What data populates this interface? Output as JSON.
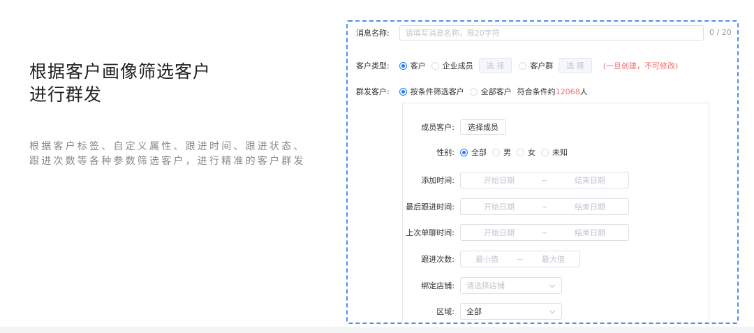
{
  "hero": {
    "title_line1": "根据客户画像筛选客户",
    "title_line2": "进行群发",
    "description": "根据客户标签、自定义属性、跟进时间、跟进状态、跟进次数等各种参数筛选客户，进行精准的客户群发"
  },
  "form": {
    "message_name": {
      "label": "消息名称:",
      "placeholder": "请填写消息名称，限20字符",
      "counter": "0 / 20"
    },
    "customer_type": {
      "label": "客户类型:",
      "options": [
        "客户",
        "企业成员",
        "客户群"
      ],
      "selected": "客户",
      "select_button": "选 择",
      "note": "(一旦创建，不可修改)"
    },
    "send_customers": {
      "label": "群发客户:",
      "options": [
        "按条件筛选客户",
        "全部客户"
      ],
      "selected": "按条件筛选客户",
      "match_prefix": "符合条件约",
      "match_count": "12068",
      "match_suffix": "人"
    },
    "filters": {
      "member_customers": {
        "label": "成员客户:",
        "button": "选择成员"
      },
      "gender": {
        "label": "性别:",
        "options": [
          "全部",
          "男",
          "女",
          "未知"
        ],
        "selected": "全部"
      },
      "add_time": {
        "label": "添加时间:",
        "start": "开始日期",
        "sep": "~",
        "end": "结束日期"
      },
      "last_follow_time": {
        "label": "最后跟进时间:",
        "start": "开始日期",
        "sep": "~",
        "end": "结束日期"
      },
      "last_chat_time": {
        "label": "上次单聊时间:",
        "start": "开始日期",
        "sep": "~",
        "end": "结束日期"
      },
      "follow_count": {
        "label": "跟进次数:",
        "min": "最小值",
        "sep": "~",
        "max": "最大值"
      },
      "bound_store": {
        "label": "绑定店铺:",
        "placeholder": "请选择店铺"
      },
      "region": {
        "label": "区域:",
        "value": "全部"
      }
    }
  },
  "colors": {
    "accent_blue": "#1f7bff",
    "dashed_border": "#4a8ef0",
    "warning_red": "#f56c6c"
  }
}
